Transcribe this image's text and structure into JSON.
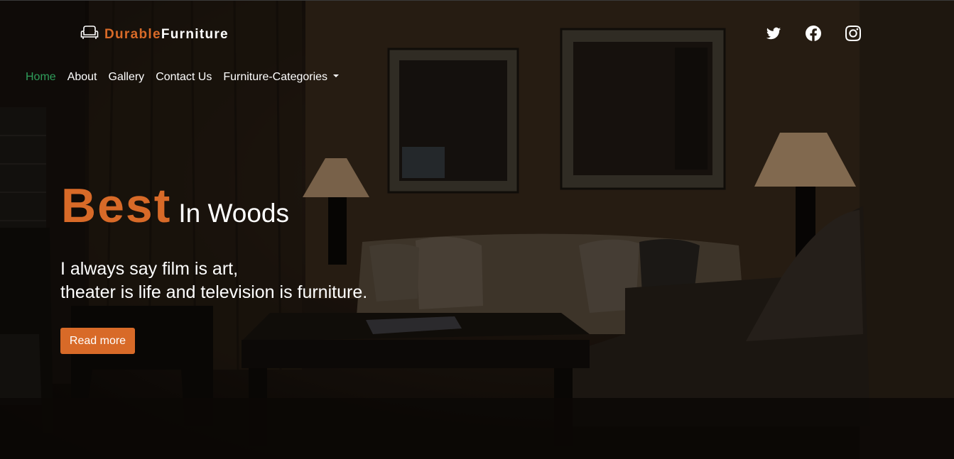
{
  "brand": {
    "part1": "Durable",
    "part2": "Furniture",
    "icon": "armchair-icon"
  },
  "social": [
    {
      "name": "twitter-icon"
    },
    {
      "name": "facebook-icon"
    },
    {
      "name": "instagram-icon"
    }
  ],
  "nav": {
    "items": [
      "Home",
      "About",
      "Gallery",
      "Contact Us"
    ],
    "dropdown": "Furniture-Categories",
    "active": "Home"
  },
  "hero": {
    "headline_big": "Best",
    "headline_small": "In Woods",
    "quote_line1": "I always say film is art,",
    "quote_line2": "theater is life and television is furniture.",
    "button": "Read more"
  },
  "colors": {
    "accent": "#d86a28",
    "active_nav": "#2f9e5b",
    "text": "#ffffff"
  }
}
